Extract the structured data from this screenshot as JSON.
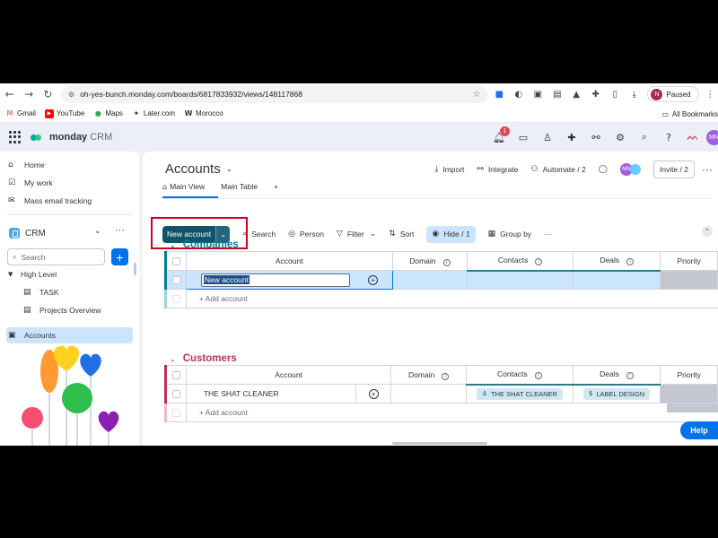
{
  "browser": {
    "url": "oh-yes-bunch.monday.com/boards/6817833932/views/148117868",
    "profile_initial": "N",
    "profile_status": "Paused"
  },
  "bookmarks": {
    "items": [
      "Gmail",
      "YouTube",
      "Maps",
      "Later.com",
      "Morocco"
    ],
    "all_bookmarks": "All Bookmarks"
  },
  "app": {
    "brand": "monday",
    "product": "CRM",
    "notification_count": "1",
    "user_initials": "MN"
  },
  "sidebar": {
    "home": "Home",
    "my_work": "My work",
    "mass_email": "Mass email tracking",
    "workspace": "CRM",
    "search_placeholder": "Search",
    "add": "+",
    "folder": "High Level",
    "items": [
      "TASK",
      "Projects Overview",
      "Accounts"
    ]
  },
  "board": {
    "title": "Accounts",
    "actions": {
      "import": "Import",
      "integrate": "Integrate",
      "automate": "Automate / 2",
      "avatar": "MN",
      "invite": "Invite / 2",
      "more": "···"
    },
    "tabs": [
      "Main View",
      "Main Table",
      "+"
    ],
    "toolbar": {
      "new_account": "New account",
      "search": "Search",
      "person": "Person",
      "filter": "Filter",
      "sort": "Sort",
      "hide": "Hide / 1",
      "group_by": "Group by",
      "more": "···"
    }
  },
  "groups": [
    {
      "name": "Companies",
      "color": "#037f98",
      "columns": [
        "Account",
        "Domain",
        "Contacts",
        "Deals",
        "Priority"
      ],
      "rows": [
        {
          "account": "New account",
          "domain": "",
          "contacts": "",
          "deals": ""
        }
      ],
      "add_label": "+ Add account"
    },
    {
      "name": "Customers",
      "color": "#bb3354",
      "columns": [
        "Account",
        "Domain",
        "Contacts",
        "Deals",
        "Priority"
      ],
      "rows": [
        {
          "account": "THE SHAT CLEANER",
          "domain": "",
          "contacts": "THE SHAT CLEANER",
          "deals": "LABEL DESIGN"
        }
      ],
      "add_label": "+ Add account"
    }
  ],
  "help": "Help",
  "colors": {
    "primary": "#0073ea",
    "new_account_button": "#0f5468",
    "highlight": "#d0021b"
  }
}
